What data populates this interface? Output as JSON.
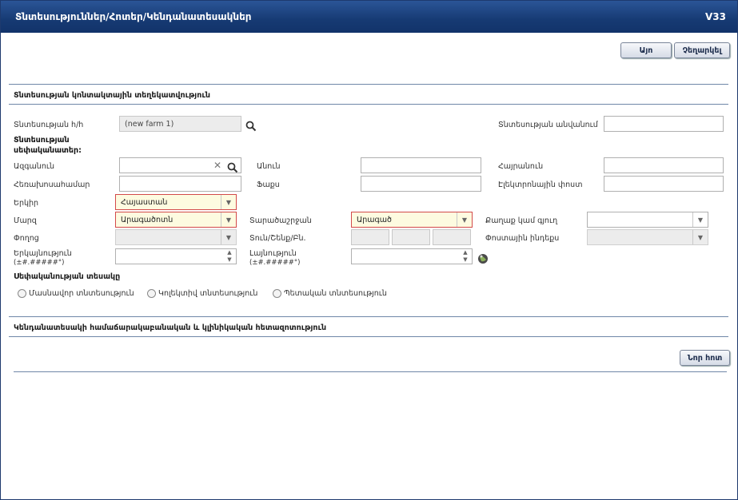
{
  "window": {
    "title": "Տնտեսություններ/Հոտեր/Կենդանատեսակներ",
    "version": "V33"
  },
  "toolbar": {
    "ok_label": "Այո",
    "cancel_label": "Չեղարկել"
  },
  "section_contact": {
    "title": "Տնտեսության կոնտակտային տեղեկատվություն"
  },
  "fields": {
    "farm_no_label": "Տնտեսության հ/հ",
    "farm_no_value": "(new farm 1)",
    "farm_name_label": "Տնտեսության անվանում",
    "owners_label": "Տնտեսության սեփականատեր:",
    "surname_label": "Ազգանուն",
    "name_label": "Անուն",
    "patronymic_label": "Հայրանուն",
    "phone_label": "Հեռախոսահամար",
    "fax_label": "Ֆաքս",
    "email_label": "Էլեկտրոնային փոստ",
    "country_label": "Երկիր",
    "country_value": "Հայաստան",
    "region_label": "Մարզ",
    "region_value": "Արագածոտն",
    "community_label": "Տարածաշրջան",
    "community_value": "Արագած",
    "city_label": "Քաղաք կամ գյուղ",
    "street_label": "Փողոց",
    "building_label": "Տուն/Շենք/Բն.",
    "postal_label": "Փոստային ինդեքս",
    "longitude_label": "Երկայնություն",
    "longitude_hint": "(±#.#####°)",
    "latitude_label": "Լայնություն",
    "latitude_hint": "(±#.#####°)"
  },
  "ownership": {
    "title": "Սեփականության տեսակը",
    "options": [
      "Մասնավոր տնտեսություն",
      "Կոլեկտիվ տնտեսություն",
      "Պետական տնտեսություն"
    ]
  },
  "section_species": {
    "title": "Կենդանատեսակի համաճարակաբանական և կլինիկական հետազոտություն"
  },
  "new_button_label": "Նոր հոտ",
  "colors": {
    "titlebar": "#163a73",
    "required_border": "#d34a4a",
    "required_bg": "#fdfbe0"
  }
}
